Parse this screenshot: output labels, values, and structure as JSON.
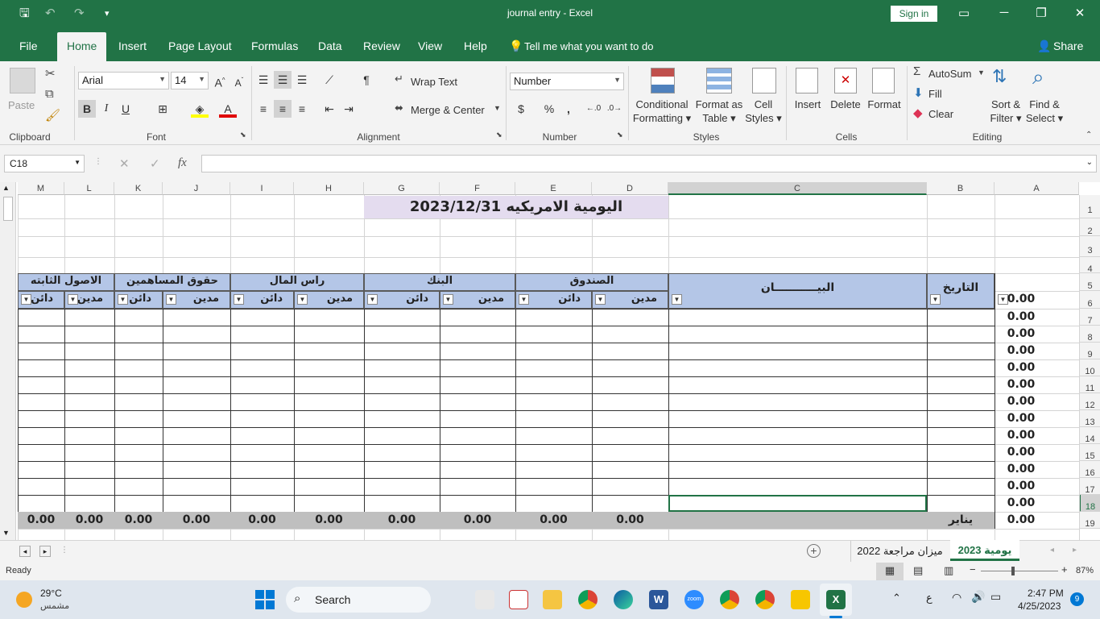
{
  "window": {
    "title": "journal entry  -  Excel",
    "sign_in": "Sign in"
  },
  "tabs": [
    "File",
    "Home",
    "Insert",
    "Page Layout",
    "Formulas",
    "Data",
    "Review",
    "View",
    "Help"
  ],
  "active_tab": "Home",
  "tell_me": "Tell me what you want to do",
  "share": "Share",
  "ribbon": {
    "clipboard": {
      "label": "Clipboard",
      "paste": "Paste"
    },
    "font": {
      "label": "Font",
      "name": "Arial",
      "size": "14",
      "bold": "B",
      "italic": "I",
      "underline": "U"
    },
    "alignment": {
      "label": "Alignment",
      "wrap": "Wrap Text",
      "merge": "Merge & Center"
    },
    "number": {
      "label": "Number",
      "format": "Number",
      "currency": "$",
      "percent": "%",
      "comma": ","
    },
    "styles": {
      "label": "Styles",
      "conditional": [
        "Conditional",
        "Formatting"
      ],
      "format_table": [
        "Format as",
        "Table"
      ],
      "cell_styles": [
        "Cell",
        "Styles"
      ]
    },
    "cells": {
      "label": "Cells",
      "insert": "Insert",
      "delete": "Delete",
      "format": "Format"
    },
    "editing": {
      "label": "Editing",
      "autosum": "AutoSum",
      "fill": "Fill",
      "clear": "Clear",
      "sort": [
        "Sort &",
        "Filter"
      ],
      "find": [
        "Find &",
        "Select"
      ]
    }
  },
  "name_box": "C18",
  "fx": "fx",
  "columns": [
    "M",
    "L",
    "K",
    "J",
    "I",
    "H",
    "G",
    "F",
    "E",
    "D",
    "C",
    "B",
    "A"
  ],
  "rows": [
    "1",
    "2",
    "3",
    "4",
    "5",
    "6",
    "7",
    "8",
    "9",
    "10",
    "11",
    "12",
    "13",
    "14",
    "15",
    "16",
    "17",
    "18",
    "19"
  ],
  "sheet": {
    "title": "اليومية الامريكيه 2023/12/31",
    "groups": [
      "الاصول الثابته",
      "حقوق المساهمين",
      "راس المال",
      "البنك",
      "الصندوق"
    ],
    "debit": "مدين",
    "credit": "دائن",
    "description": "البيـــــــــــان",
    "date": "التاريخ",
    "a_values": [
      "0.00",
      "0.00",
      "0.00",
      "0.00",
      "0.00",
      "0.00",
      "0.00",
      "0.00",
      "0.00",
      "0.00",
      "0.00",
      "0.00",
      "0.00",
      "0.00"
    ],
    "totals": [
      "0.00",
      "0.00",
      "0.00",
      "0.00",
      "0.00",
      "0.00",
      "0.00",
      "0.00",
      "0.00",
      "0.00"
    ],
    "month": "يناير"
  },
  "sheet_tabs": [
    "يومية 2023",
    "ميزان مراجعة 2022"
  ],
  "status": {
    "ready": "Ready",
    "zoom": "87%"
  },
  "taskbar": {
    "weather_temp": "29°C",
    "weather_desc": "مشمس",
    "search": "Search",
    "time": "2:47 PM",
    "date": "4/25/2023",
    "lang": "ع",
    "badge": "9"
  }
}
